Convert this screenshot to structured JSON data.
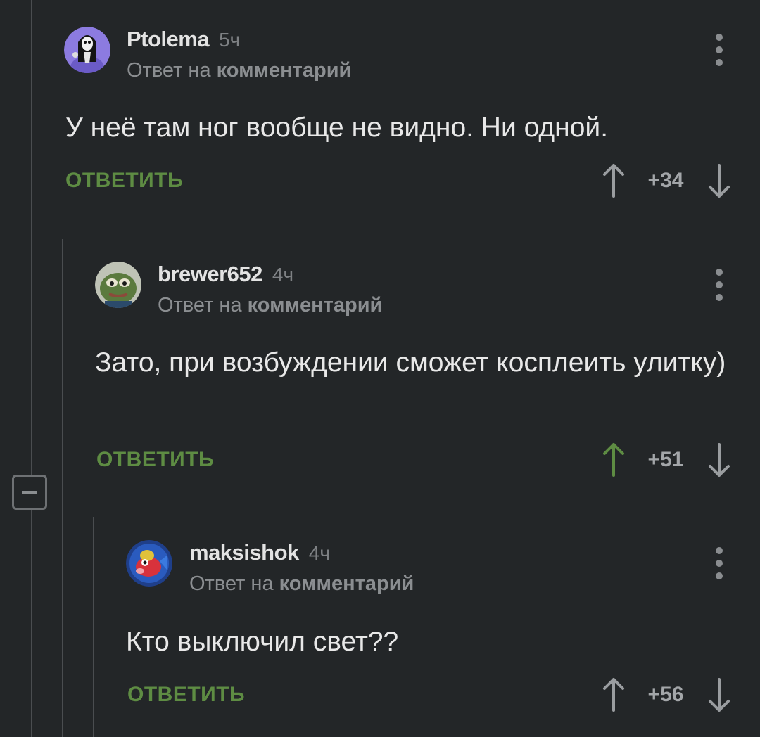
{
  "comments": [
    {
      "username": "Ptolema",
      "time": "5ч",
      "reply_prefix": "Ответ на",
      "reply_target": "комментарий",
      "text": "У неё там ног вообще не видно. Ни одной.",
      "reply_label": "ОТВЕТИТЬ",
      "score": "+34",
      "upvoted": false
    },
    {
      "username": "brewer652",
      "time": "4ч",
      "reply_prefix": "Ответ на",
      "reply_target": "комментарий",
      "text": "Зато, при возбуждении сможет косплеить улитку)",
      "reply_label": "ОТВЕТИТЬ",
      "score": "+51",
      "upvoted": true
    },
    {
      "username": "maksishok",
      "time": "4ч",
      "reply_prefix": "Ответ на",
      "reply_target": "комментарий",
      "text": "Кто выключил свет??",
      "reply_label": "ОТВЕТИТЬ",
      "score": "+56",
      "upvoted": false
    }
  ],
  "colors": {
    "background": "#232628",
    "accent_green": "#5e8c43",
    "upvote_active": "#5e8c43",
    "muted": "#8b8e91"
  }
}
